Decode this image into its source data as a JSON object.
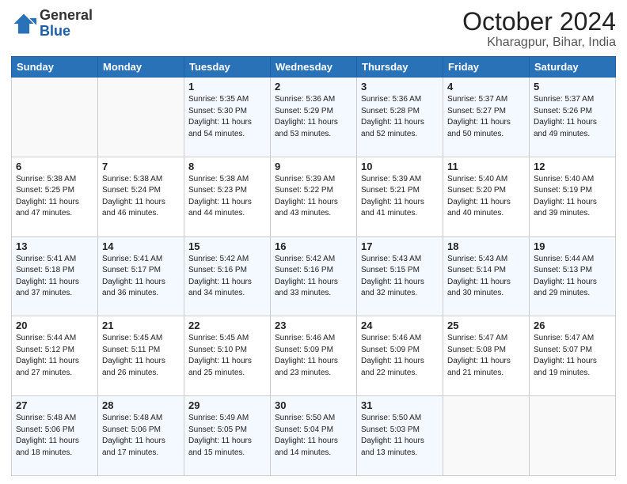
{
  "header": {
    "logo_general": "General",
    "logo_blue": "Blue",
    "month": "October 2024",
    "location": "Kharagpur, Bihar, India"
  },
  "weekdays": [
    "Sunday",
    "Monday",
    "Tuesday",
    "Wednesday",
    "Thursday",
    "Friday",
    "Saturday"
  ],
  "weeks": [
    [
      {
        "day": "",
        "info": ""
      },
      {
        "day": "",
        "info": ""
      },
      {
        "day": "1",
        "info": "Sunrise: 5:35 AM\nSunset: 5:30 PM\nDaylight: 11 hours and 54 minutes."
      },
      {
        "day": "2",
        "info": "Sunrise: 5:36 AM\nSunset: 5:29 PM\nDaylight: 11 hours and 53 minutes."
      },
      {
        "day": "3",
        "info": "Sunrise: 5:36 AM\nSunset: 5:28 PM\nDaylight: 11 hours and 52 minutes."
      },
      {
        "day": "4",
        "info": "Sunrise: 5:37 AM\nSunset: 5:27 PM\nDaylight: 11 hours and 50 minutes."
      },
      {
        "day": "5",
        "info": "Sunrise: 5:37 AM\nSunset: 5:26 PM\nDaylight: 11 hours and 49 minutes."
      }
    ],
    [
      {
        "day": "6",
        "info": "Sunrise: 5:38 AM\nSunset: 5:25 PM\nDaylight: 11 hours and 47 minutes."
      },
      {
        "day": "7",
        "info": "Sunrise: 5:38 AM\nSunset: 5:24 PM\nDaylight: 11 hours and 46 minutes."
      },
      {
        "day": "8",
        "info": "Sunrise: 5:38 AM\nSunset: 5:23 PM\nDaylight: 11 hours and 44 minutes."
      },
      {
        "day": "9",
        "info": "Sunrise: 5:39 AM\nSunset: 5:22 PM\nDaylight: 11 hours and 43 minutes."
      },
      {
        "day": "10",
        "info": "Sunrise: 5:39 AM\nSunset: 5:21 PM\nDaylight: 11 hours and 41 minutes."
      },
      {
        "day": "11",
        "info": "Sunrise: 5:40 AM\nSunset: 5:20 PM\nDaylight: 11 hours and 40 minutes."
      },
      {
        "day": "12",
        "info": "Sunrise: 5:40 AM\nSunset: 5:19 PM\nDaylight: 11 hours and 39 minutes."
      }
    ],
    [
      {
        "day": "13",
        "info": "Sunrise: 5:41 AM\nSunset: 5:18 PM\nDaylight: 11 hours and 37 minutes."
      },
      {
        "day": "14",
        "info": "Sunrise: 5:41 AM\nSunset: 5:17 PM\nDaylight: 11 hours and 36 minutes."
      },
      {
        "day": "15",
        "info": "Sunrise: 5:42 AM\nSunset: 5:16 PM\nDaylight: 11 hours and 34 minutes."
      },
      {
        "day": "16",
        "info": "Sunrise: 5:42 AM\nSunset: 5:16 PM\nDaylight: 11 hours and 33 minutes."
      },
      {
        "day": "17",
        "info": "Sunrise: 5:43 AM\nSunset: 5:15 PM\nDaylight: 11 hours and 32 minutes."
      },
      {
        "day": "18",
        "info": "Sunrise: 5:43 AM\nSunset: 5:14 PM\nDaylight: 11 hours and 30 minutes."
      },
      {
        "day": "19",
        "info": "Sunrise: 5:44 AM\nSunset: 5:13 PM\nDaylight: 11 hours and 29 minutes."
      }
    ],
    [
      {
        "day": "20",
        "info": "Sunrise: 5:44 AM\nSunset: 5:12 PM\nDaylight: 11 hours and 27 minutes."
      },
      {
        "day": "21",
        "info": "Sunrise: 5:45 AM\nSunset: 5:11 PM\nDaylight: 11 hours and 26 minutes."
      },
      {
        "day": "22",
        "info": "Sunrise: 5:45 AM\nSunset: 5:10 PM\nDaylight: 11 hours and 25 minutes."
      },
      {
        "day": "23",
        "info": "Sunrise: 5:46 AM\nSunset: 5:09 PM\nDaylight: 11 hours and 23 minutes."
      },
      {
        "day": "24",
        "info": "Sunrise: 5:46 AM\nSunset: 5:09 PM\nDaylight: 11 hours and 22 minutes."
      },
      {
        "day": "25",
        "info": "Sunrise: 5:47 AM\nSunset: 5:08 PM\nDaylight: 11 hours and 21 minutes."
      },
      {
        "day": "26",
        "info": "Sunrise: 5:47 AM\nSunset: 5:07 PM\nDaylight: 11 hours and 19 minutes."
      }
    ],
    [
      {
        "day": "27",
        "info": "Sunrise: 5:48 AM\nSunset: 5:06 PM\nDaylight: 11 hours and 18 minutes."
      },
      {
        "day": "28",
        "info": "Sunrise: 5:48 AM\nSunset: 5:06 PM\nDaylight: 11 hours and 17 minutes."
      },
      {
        "day": "29",
        "info": "Sunrise: 5:49 AM\nSunset: 5:05 PM\nDaylight: 11 hours and 15 minutes."
      },
      {
        "day": "30",
        "info": "Sunrise: 5:50 AM\nSunset: 5:04 PM\nDaylight: 11 hours and 14 minutes."
      },
      {
        "day": "31",
        "info": "Sunrise: 5:50 AM\nSunset: 5:03 PM\nDaylight: 11 hours and 13 minutes."
      },
      {
        "day": "",
        "info": ""
      },
      {
        "day": "",
        "info": ""
      }
    ]
  ]
}
